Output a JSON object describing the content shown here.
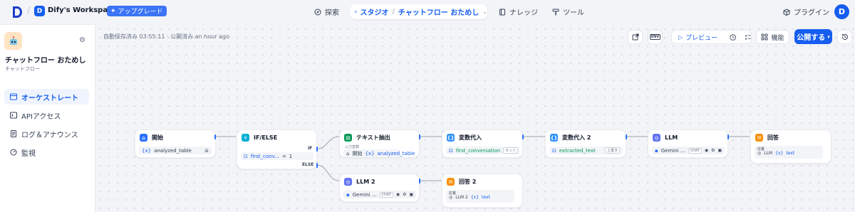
{
  "header": {
    "workspace_initial": "D",
    "workspace_name": "Dify's Workspace",
    "upgrade_label": "アップグレード",
    "nav_explore": "探索",
    "nav_studio": "スタジオ",
    "current_app": "チャットフロー おためし",
    "nav_knowledge": "ナレッジ",
    "nav_tools": "ツール",
    "plugins_label": "プラグイン",
    "user_initial": "D"
  },
  "sidebar": {
    "app_name": "チャットフロー おためし",
    "app_type": "チャットフロー",
    "items": [
      {
        "label": "オーケストレート",
        "icon": "layout-icon"
      },
      {
        "label": "APIアクセス",
        "icon": "terminal-icon"
      },
      {
        "label": "ログ＆アナウンス",
        "icon": "file-list-icon"
      },
      {
        "label": "監視",
        "icon": "dashboard-icon"
      }
    ]
  },
  "toolbar": {
    "autosave_status": "自動保存済み 03:55:11 · 公開済み an hour ago",
    "env_label": "ENV",
    "preview_label": "プレビュー",
    "features_label": "機能",
    "publish_label": "公開する"
  },
  "nodes": {
    "start": {
      "title": "開始",
      "var": "analyzed_table"
    },
    "ifelse": {
      "title": "IF/ELSE",
      "if_label": "IF",
      "else_label": "ELSE",
      "cond_var": "first_conv...",
      "cond_op": "=",
      "cond_val": "1"
    },
    "extract": {
      "title": "テキスト抽出",
      "input_label": "入力変数",
      "source": "開始",
      "var": "analyzed_table"
    },
    "assign1": {
      "title": "変数代入",
      "var": "first_conversation",
      "mode": "セット"
    },
    "assign2": {
      "title": "変数代入 2",
      "var": "extracted_text",
      "mode": "上書き"
    },
    "llm": {
      "title": "LLM",
      "model": "Gemini ...",
      "tag": "CHAT"
    },
    "answer": {
      "title": "回答",
      "label": "応答",
      "source": "LLM",
      "var": "text"
    },
    "llm2": {
      "title": "LLM 2",
      "model": "Gemini ...",
      "tag": "CHAT"
    },
    "answer2": {
      "title": "回答 2",
      "label": "応答",
      "source": "LLM 2",
      "var": "text"
    }
  },
  "colors": {
    "accent": "#155eef",
    "start_icon": "#2970ff",
    "ifelse_icon": "#06aed4",
    "extract_icon": "#039855",
    "assign_icon": "#2e90fa",
    "llm_icon": "#6172f3",
    "answer_icon": "#f79009"
  }
}
